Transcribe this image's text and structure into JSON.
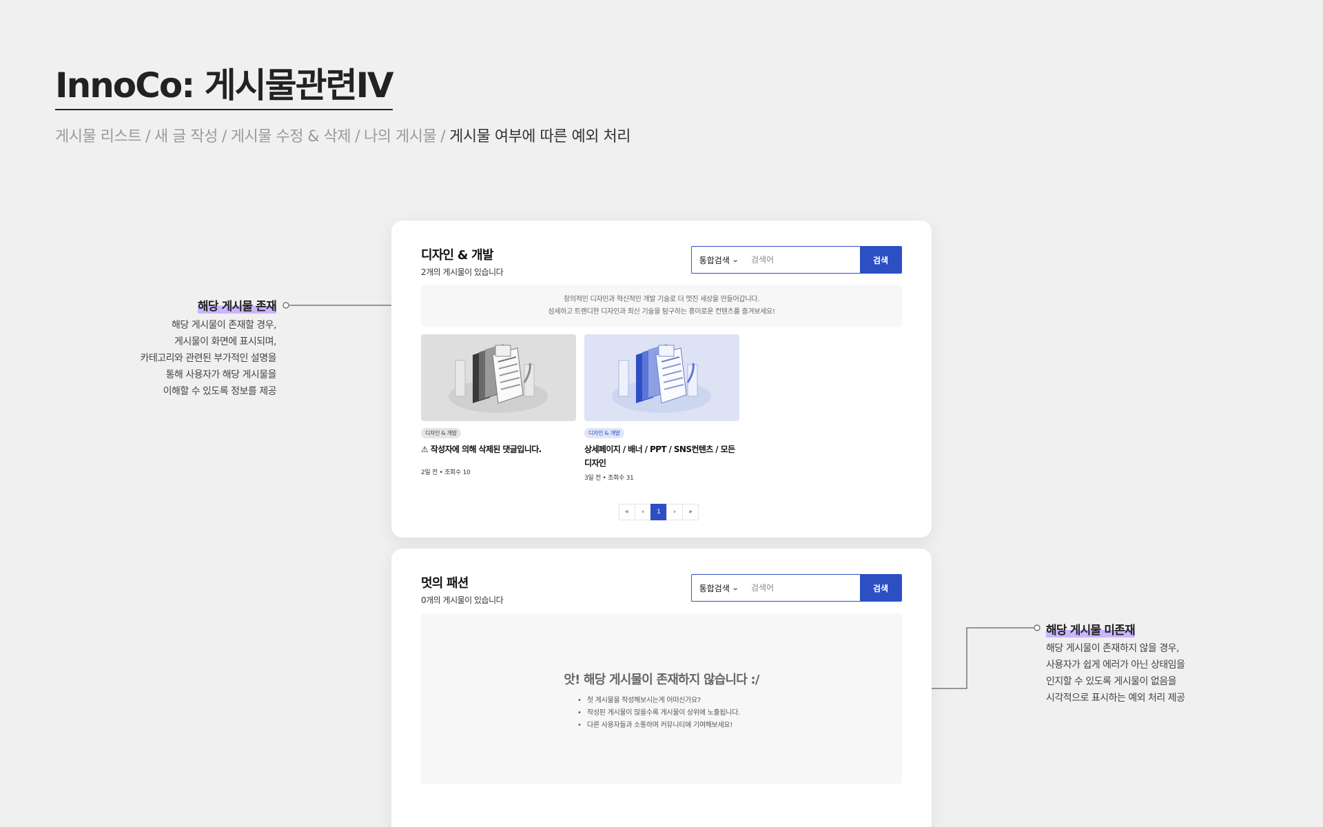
{
  "header": {
    "title": "InnoCo: 게시물관련Ⅳ",
    "breadcrumb": [
      "게시물 리스트",
      "새 글 작성",
      "게시물 수정 & 삭제",
      "나의 게시물"
    ],
    "breadcrumb_current": "게시물 여부에 따른 예외 처리",
    "separator": "/"
  },
  "annotations": {
    "exists": {
      "title": "해당 게시물 존재",
      "lines": [
        "해당 게시물이 존재할 경우,",
        "게시물이 화면에 표시되며,",
        "카테고리와 관련된 부가적인 설명을",
        "통해 사용자가 해당 게시물을",
        "이해할 수 있도록 정보를 제공"
      ]
    },
    "missing": {
      "title": "해당 게시물 미존재",
      "lines": [
        "해당 게시물이 존재하지 않을 경우,",
        "사용자가 쉽게 에러가 아닌 상태임을",
        "인지할 수 있도록 게시물이 없음을",
        "시각적으로 표시하는 예외 처리 제공"
      ]
    }
  },
  "board_design": {
    "title": "디자인 & 개발",
    "count": "2개의 게시물이 있습니다",
    "search": {
      "scope": "통합검색",
      "placeholder": "검색어",
      "button": "검색"
    },
    "intro": [
      "창의적인 디자인과 혁신적인 개발 기술로 더 멋진 세상을 만들어갑니다.",
      "섬세하고 트렌디한 디자인과 최신 기술을 탐구하는 흥미로운 컨텐츠를 즐겨보세요!"
    ],
    "posts": [
      {
        "badge": "디자인 & 개발",
        "title": "⚠ 작성자에 의해 삭제된 댓글입니다.",
        "meta": "2일 전 • 조회수 10",
        "theme": "gray"
      },
      {
        "badge": "디자인 & 개발",
        "title": "상세페이지 / 배너 / PPT / SNS컨텐츠 / 모든디자인",
        "meta": "3일 전 • 조회수 31",
        "theme": "blue"
      }
    ],
    "pagination": {
      "first": "«",
      "prev": "‹",
      "current": "1",
      "next": "›",
      "last": "»"
    }
  },
  "board_fashion": {
    "title": "멋의 패션",
    "count": "0개의 게시물이 있습니다",
    "search": {
      "scope": "통합검색",
      "placeholder": "검색어",
      "button": "검색"
    },
    "empty": {
      "title": "앗! 해당 게시물이 존재하지 않습니다 :/",
      "tips": [
        "첫 게시물을 작성해보시는게 어떠신가요?",
        "작성된 게시물이 많을수록 게시물이 상위에 노출됩니다.",
        "다른 사용자들과 소통하며 커뮤니티에 기여해보세요!"
      ]
    }
  },
  "colors": {
    "accent": "#2d4fc4",
    "highlight": "#c9b6ff",
    "background": "#f0f0f0"
  },
  "icons": {
    "scope_dropdown": "chevron-down-icon",
    "thumbnail": "document-stack-illustration",
    "connector_dot": "circle-dot-icon"
  }
}
